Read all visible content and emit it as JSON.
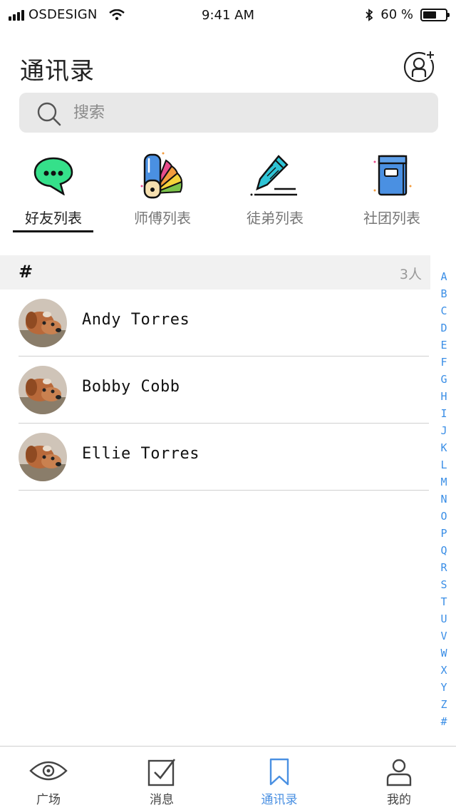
{
  "status_bar": {
    "carrier": "OSDESIGN",
    "time": "9:41 AM",
    "battery_percent": "60 %",
    "battery_level": 0.6
  },
  "header": {
    "title": "通讯录",
    "add_icon": "add-friend-icon"
  },
  "search": {
    "placeholder": "搜索"
  },
  "categories": [
    {
      "label": "好友列表",
      "icon": "chat-bubble-icon",
      "active": true
    },
    {
      "label": "师傅列表",
      "icon": "color-swatch-icon",
      "active": false
    },
    {
      "label": "徒弟列表",
      "icon": "pencil-icon",
      "active": false
    },
    {
      "label": "社团列表",
      "icon": "book-icon",
      "active": false
    }
  ],
  "section": {
    "letter": "#",
    "count": "3人"
  },
  "contacts": [
    {
      "name": "Andy Torres"
    },
    {
      "name": "Bobby Cobb"
    },
    {
      "name": "Ellie Torres"
    }
  ],
  "index_letters": [
    "A",
    "B",
    "C",
    "D",
    "E",
    "F",
    "G",
    "H",
    "I",
    "J",
    "K",
    "L",
    "M",
    "N",
    "O",
    "P",
    "Q",
    "R",
    "S",
    "T",
    "U",
    "V",
    "W",
    "X",
    "Y",
    "Z",
    "#"
  ],
  "bottom_nav": [
    {
      "label": "广场",
      "icon": "eye-icon",
      "active": false
    },
    {
      "label": "消息",
      "icon": "checkbox-icon",
      "active": false
    },
    {
      "label": "通讯录",
      "icon": "bookmark-icon",
      "active": true
    },
    {
      "label": "我的",
      "icon": "user-icon",
      "active": false
    }
  ],
  "colors": {
    "accent": "#4a90e2",
    "index": "#3a8ee6",
    "chat_icon": "#35e08a"
  }
}
